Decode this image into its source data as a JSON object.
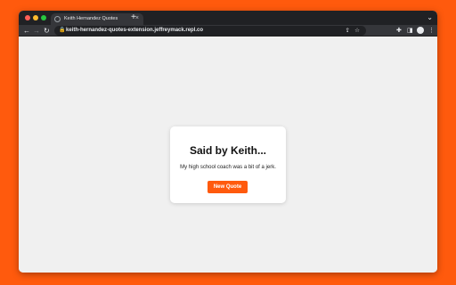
{
  "browser": {
    "tab": {
      "title": "Keith Hernandez Quotes",
      "close_glyph": "×",
      "favicon": "globe-icon"
    },
    "new_tab_glyph": "+",
    "tab_menu_glyph": "⌄",
    "nav": {
      "back_glyph": "←",
      "forward_glyph": "→",
      "reload_glyph": "↻"
    },
    "address_bar": {
      "lock_glyph": "🔒",
      "url": "keith-hernandez-quotes-extension.jeffreymack.repl.co",
      "share_glyph": "⇪",
      "bookmark_glyph": "☆"
    },
    "toolbar_icons": {
      "extensions_glyph": "✚",
      "side_panel_glyph": "◨",
      "menu_glyph": "⋮"
    }
  },
  "page": {
    "background_color": "#f0f0f0",
    "card": {
      "title": "Said by Keith...",
      "quote": "My high school coach was a bit of a jerk.",
      "button_label": "New Quote",
      "accent_color": "#ff5a0d"
    }
  },
  "desktop": {
    "background_color": "#ff5a0d"
  }
}
